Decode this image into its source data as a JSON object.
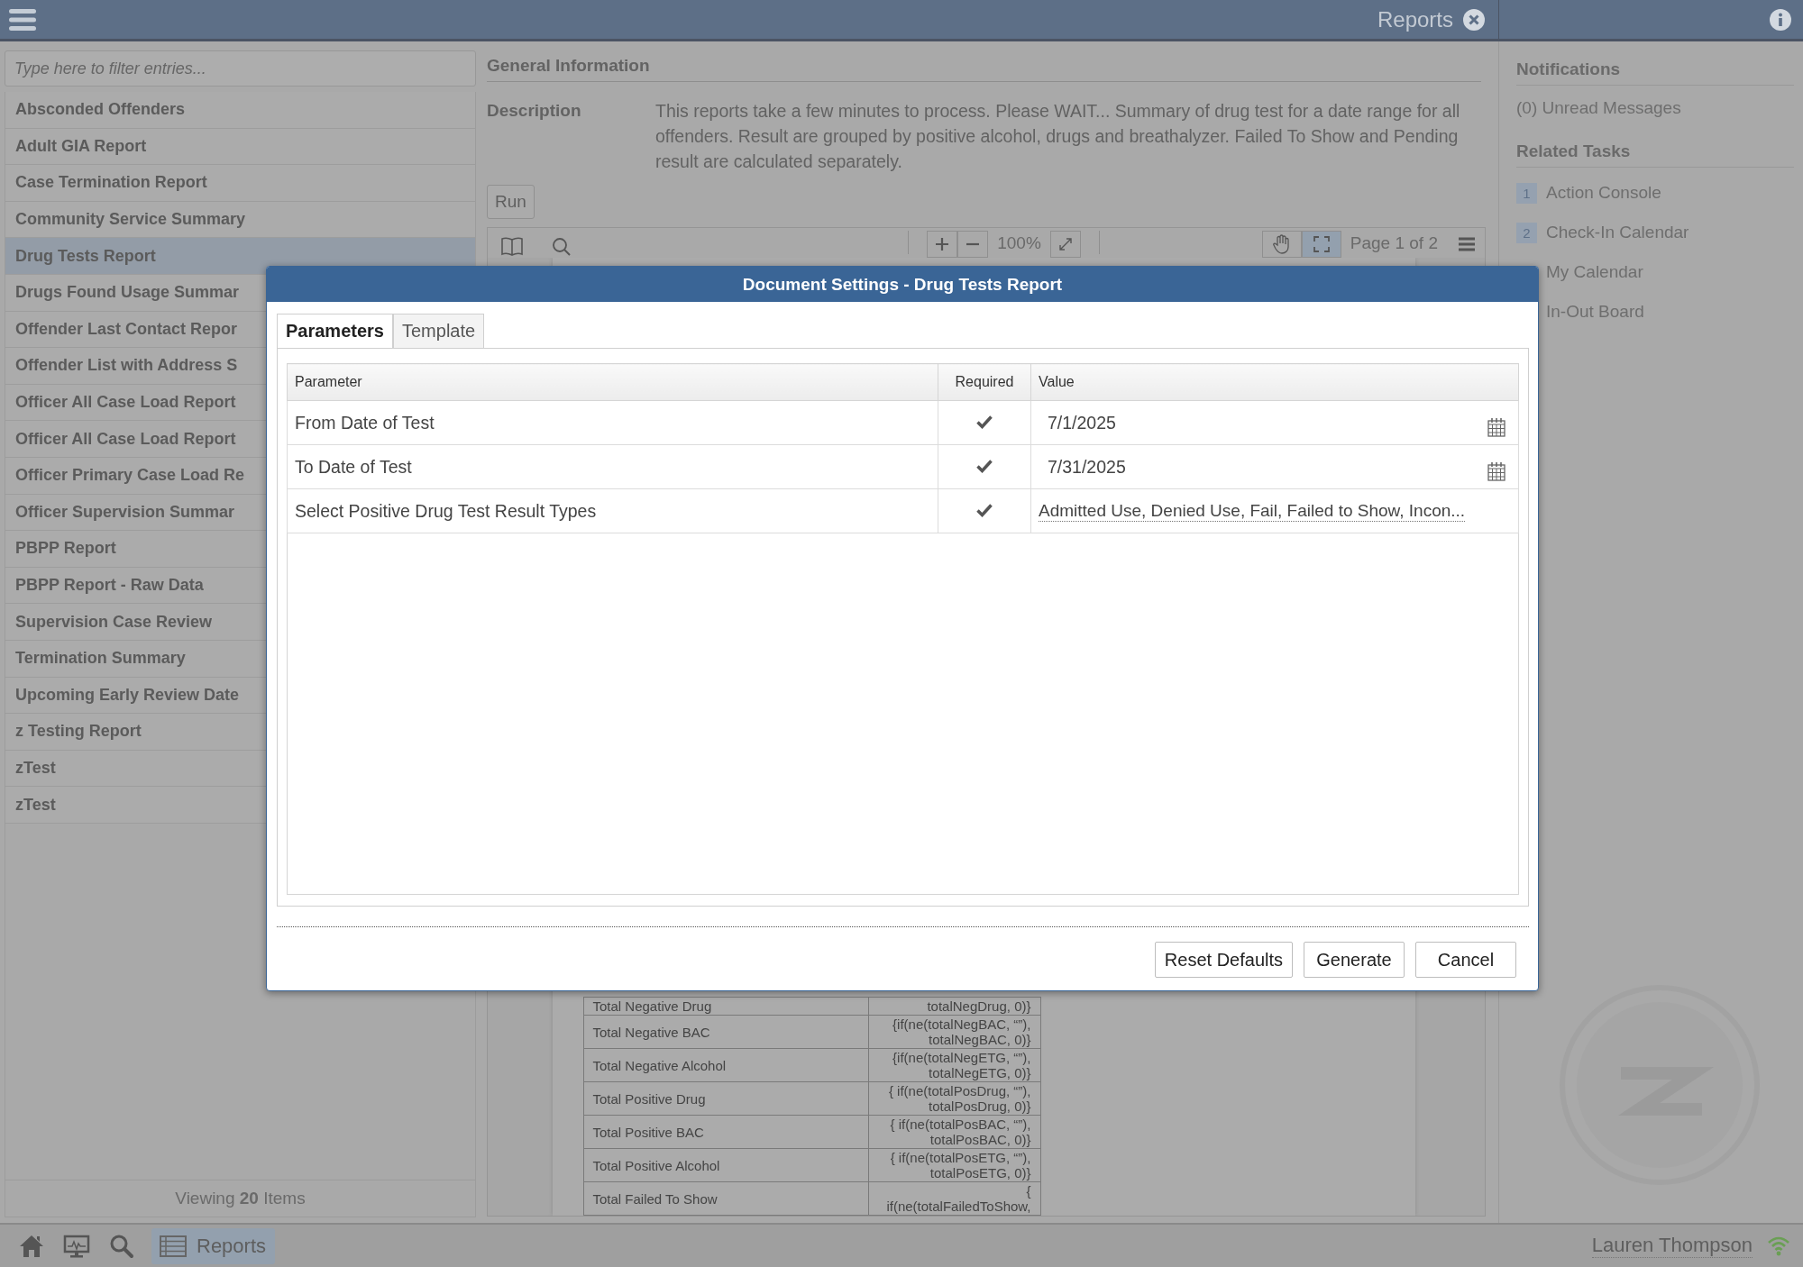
{
  "header": {
    "title": "Reports"
  },
  "sidebar": {
    "filter": {
      "placeholder": "Type here to filter entries..."
    },
    "items": [
      {
        "label": "Absconded Offenders",
        "selected": false
      },
      {
        "label": "Adult GIA Report",
        "selected": false
      },
      {
        "label": "Case Termination Report",
        "selected": false
      },
      {
        "label": "Community Service Summary",
        "selected": false
      },
      {
        "label": "Drug Tests Report",
        "selected": true
      },
      {
        "label": "Drugs Found Usage Summar",
        "selected": false
      },
      {
        "label": "Offender Last Contact Repor",
        "selected": false
      },
      {
        "label": "Offender List with Address S",
        "selected": false
      },
      {
        "label": "Officer All Case Load Report",
        "selected": false
      },
      {
        "label": "Officer All Case Load Report",
        "selected": false
      },
      {
        "label": "Officer Primary Case Load Re",
        "selected": false
      },
      {
        "label": "Officer Supervision Summar",
        "selected": false
      },
      {
        "label": "PBPP Report",
        "selected": false
      },
      {
        "label": "PBPP Report - Raw Data",
        "selected": false
      },
      {
        "label": "Supervision Case Review",
        "selected": false
      },
      {
        "label": "Termination Summary",
        "selected": false
      },
      {
        "label": "Upcoming Early Review Date",
        "selected": false
      },
      {
        "label": "z Testing Report",
        "selected": false
      },
      {
        "label": "zTest",
        "selected": false
      },
      {
        "label": "zTest",
        "selected": false
      }
    ],
    "footer": "Viewing **20** Items"
  },
  "general_information": {
    "heading": "General Information",
    "description_label": "Description",
    "description": "This reports take a few minutes to process. Please WAIT... Summary of drug test for a date range for all offenders. Result are grouped by positive alcohol, drugs and breathalyzer. Failed To Show and Pending result are calculated separately.",
    "run_button": "Run"
  },
  "viewer_toolbar": {
    "zoom_level": "100%",
    "page_label": "Page 1 of 2",
    "tools": [
      {
        "kind": "pan",
        "selected": false
      },
      {
        "kind": "fit",
        "selected": true
      }
    ]
  },
  "report_rows": [
    {
      "label": "Total Negative Drug",
      "value": [
        "totalNegDrug, 0)}"
      ]
    },
    {
      "label": "Total Negative BAC",
      "value": [
        "{if(ne(totalNegBAC, “”),",
        "totalNegBAC, 0)}"
      ]
    },
    {
      "label": "Total Negative Alcohol",
      "value": [
        "{if(ne(totalNegETG, “”),",
        "totalNegETG, 0)}"
      ]
    },
    {
      "label": "Total Positive Drug",
      "value": [
        "{ if(ne(totalPosDrug, “”),",
        "totalPosDrug, 0)}"
      ]
    },
    {
      "label": "Total Positive BAC",
      "value": [
        "{ if(ne(totalPosBAC, “”),",
        "totalPosBAC, 0)}"
      ]
    },
    {
      "label": "Total Positive Alcohol",
      "value": [
        "{ if(ne(totalPosETG, “”),",
        "totalPosETG, 0)}"
      ]
    },
    {
      "label": "Total Failed To Show",
      "value": [
        "{",
        "if(ne(totalFailedToShow,"
      ]
    }
  ],
  "notifications": {
    "heading": "Notifications",
    "text": "(0) Unread Messages"
  },
  "related_tasks": {
    "heading": "Related Tasks",
    "items": [
      {
        "number": "1",
        "label": "Action Console"
      },
      {
        "number": "2",
        "label": "Check-In Calendar"
      },
      {
        "label": "My Calendar"
      },
      {
        "label": "In-Out Board"
      }
    ]
  },
  "dialog": {
    "title": "Document Settings - Drug Tests Report",
    "tabs": [
      {
        "label": "Parameters",
        "selected": true
      },
      {
        "label": "Template",
        "selected": false
      }
    ],
    "columns": [
      "Parameter",
      "Required",
      "Value"
    ],
    "parameters": [
      {
        "name": "From Date of Test",
        "required": true,
        "kind": "date",
        "value": "7/1/2025"
      },
      {
        "name": "To Date of Test",
        "required": true,
        "kind": "date",
        "value": "7/31/2025"
      },
      {
        "name": "Select Positive Drug Test Result Types",
        "required": true,
        "kind": "list",
        "value": "Admitted Use, Denied Use, Fail, Failed to Show, Incon..."
      }
    ],
    "buttons": [
      "Reset Defaults",
      "Generate",
      "Cancel"
    ]
  },
  "taskbar": {
    "items": [
      {
        "kind": "home",
        "selected": false
      },
      {
        "kind": "monitor",
        "selected": false
      },
      {
        "kind": "search",
        "selected": false
      },
      {
        "kind": "reports",
        "label": "Reports",
        "selected": true
      }
    ],
    "user": "Lauren Thompson"
  }
}
